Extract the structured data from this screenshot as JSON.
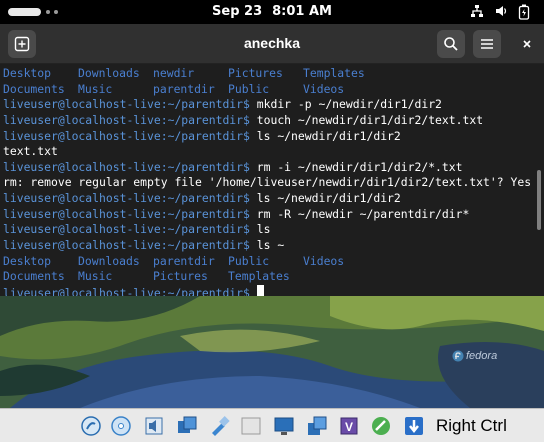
{
  "topbar": {
    "date": "Sep 23",
    "time": "8:01 AM"
  },
  "window": {
    "title": "anechka"
  },
  "terminal": {
    "lines": [
      {
        "type": "list",
        "items": [
          "Desktop",
          "Downloads",
          "newdir",
          "Pictures",
          "Templates"
        ]
      },
      {
        "type": "list",
        "items": [
          "Documents",
          "Music",
          "parentdir",
          "Public",
          "Videos"
        ]
      },
      {
        "type": "cmd",
        "prompt": "liveuser@localhost-live:~/parentdir$",
        "command": " mkdir -p ~/newdir/dir1/dir2"
      },
      {
        "type": "cmd",
        "prompt": "liveuser@localhost-live:~/parentdir$",
        "command": " touch ~/newdir/dir1/dir2/text.txt"
      },
      {
        "type": "cmd",
        "prompt": "liveuser@localhost-live:~/parentdir$",
        "command": " ls ~/newdir/dir1/dir2"
      },
      {
        "type": "out",
        "text": "text.txt"
      },
      {
        "type": "cmd",
        "prompt": "liveuser@localhost-live:~/parentdir$",
        "command": " rm -i ~/newdir/dir1/dir2/*.txt"
      },
      {
        "type": "out",
        "text": "rm: remove regular empty file '/home/liveuser/newdir/dir1/dir2/text.txt'? Yes"
      },
      {
        "type": "cmd",
        "prompt": "liveuser@localhost-live:~/parentdir$",
        "command": " ls ~/newdir/dir1/dir2"
      },
      {
        "type": "cmd",
        "prompt": "liveuser@localhost-live:~/parentdir$",
        "command": " rm -R ~/newdir ~/parentdir/dir*"
      },
      {
        "type": "cmd",
        "prompt": "liveuser@localhost-live:~/parentdir$",
        "command": " ls"
      },
      {
        "type": "cmd",
        "prompt": "liveuser@localhost-live:~/parentdir$",
        "command": " ls ~"
      },
      {
        "type": "list",
        "items": [
          "Desktop",
          "Downloads",
          "parentdir",
          "Public",
          "Videos"
        ]
      },
      {
        "type": "list",
        "items": [
          "Documents",
          "Music",
          "Pictures",
          "Templates",
          ""
        ]
      },
      {
        "type": "cmd",
        "prompt": "liveuser@localhost-live:~/parentdir$",
        "command": " ",
        "cursor": true
      }
    ]
  },
  "wallpaper": {
    "brand": "fedora"
  },
  "vbox": {
    "host_key": "Right Ctrl"
  },
  "colors": {
    "prompt": "#5a93d8",
    "dir": "#4a7fd0",
    "terminal_bg": "#1e1e1e",
    "headerbar_bg": "#303030"
  }
}
